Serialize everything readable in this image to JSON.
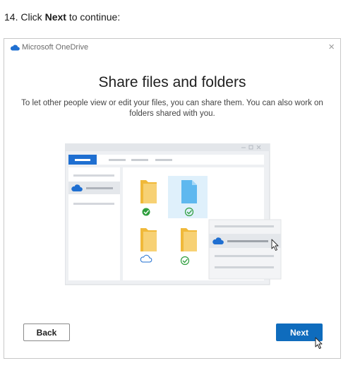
{
  "instruction": {
    "prefix": "14. Click ",
    "bold": "Next",
    "suffix": " to continue:"
  },
  "window": {
    "title": "Microsoft OneDrive",
    "close_glyph": "×"
  },
  "dialog": {
    "heading": "Share files and folders",
    "description": "To let other people view or edit your files, you can share them. You can also work on folders shared with you.",
    "back_label": "Back",
    "next_label": "Next"
  },
  "colors": {
    "accent": "#0f6cbd",
    "onedrive_blue": "#1f6fd1",
    "folder_yellow": "#f5c04a",
    "check_green": "#2e9e3e"
  },
  "icons": [
    "onedrive-cloud-icon",
    "close-icon",
    "folder-icon",
    "file-icon",
    "check-icon",
    "cloud-icon",
    "mouse-cursor-icon"
  ]
}
